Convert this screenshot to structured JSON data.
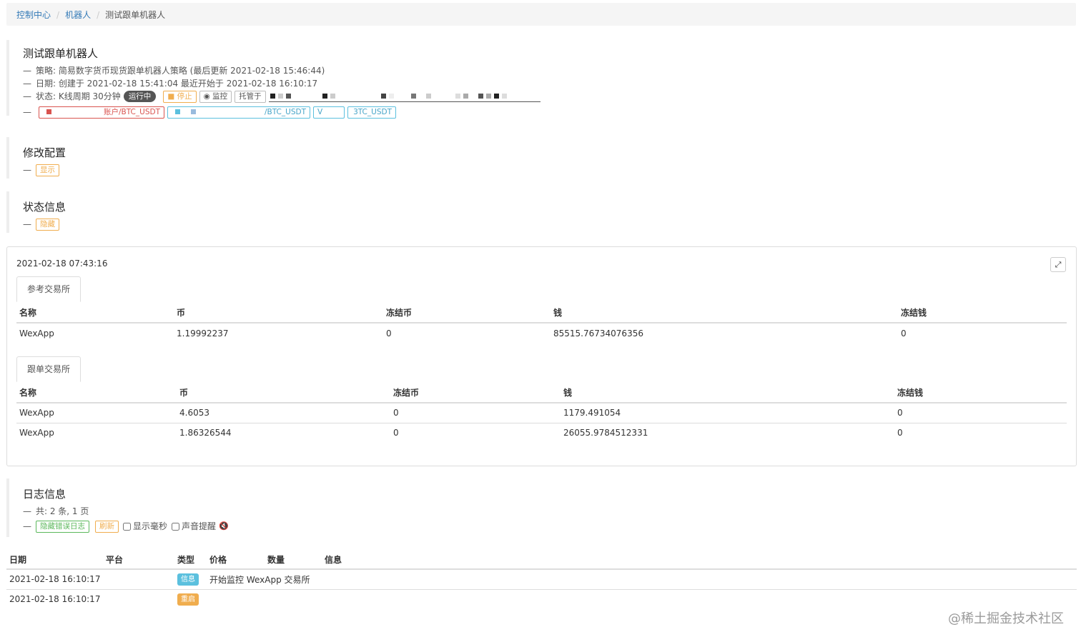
{
  "breadcrumb": {
    "home": "控制中心",
    "robots": "机器人",
    "current": "测试跟单机器人"
  },
  "robot": {
    "title": "测试跟单机器人",
    "strategy_line": "策略: 简易数字货币现货跟单机器人策略 (最后更新 2021-02-18 15:46:44)",
    "date_line": "日期: 创建于 2021-02-18 15:41:04 最近开始于 2021-02-18 16:10:17",
    "status_prefix": "状态: K线周期 30分钟",
    "status_badge": "运行中",
    "stop_label": "停止",
    "monitor_label": "监控",
    "custody_label": "托管于",
    "exchange_labels": [
      "账户/BTC_USDT",
      "/BTC_USDT",
      "V",
      "3TC_USDT"
    ]
  },
  "config": {
    "title": "修改配置",
    "toggle_label": "显示"
  },
  "status_info": {
    "title": "状态信息",
    "toggle_label": "隐藏"
  },
  "status_panel": {
    "timestamp": "2021-02-18 07:43:16",
    "ref_tab": "参考交易所",
    "follow_tab": "跟单交易所",
    "columns": [
      "名称",
      "币",
      "冻结币",
      "钱",
      "冻结钱"
    ],
    "ref_rows": [
      [
        "WexApp",
        "1.19992237",
        "0",
        "85515.76734076356",
        "0"
      ]
    ],
    "follow_rows": [
      [
        "WexApp",
        "4.6053",
        "0",
        "1179.491054",
        "0"
      ],
      [
        "WexApp",
        "1.86326544",
        "0",
        "26055.9784512331",
        "0"
      ]
    ]
  },
  "log": {
    "title": "日志信息",
    "summary": "共: 2 条, 1 页",
    "hide_errors_label": "隐藏错误日志",
    "refresh_label": "刷新",
    "show_ms_label": "显示毫秒",
    "sound_label": "声音提醒",
    "columns": [
      "日期",
      "平台",
      "类型",
      "价格",
      "数量",
      "信息"
    ],
    "rows": [
      {
        "date": "2021-02-18 16:10:17",
        "type": "信息",
        "message": "开始监控 WexApp 交易所"
      },
      {
        "date": "2021-02-18 16:10:17",
        "type": "重启",
        "message": ""
      }
    ]
  },
  "watermark": "@稀土掘金技术社区",
  "colors": {
    "link": "#337ab7",
    "warning": "#f0ad4e",
    "info": "#5bc0de",
    "danger": "#d9534f",
    "success": "#5cb85c"
  }
}
